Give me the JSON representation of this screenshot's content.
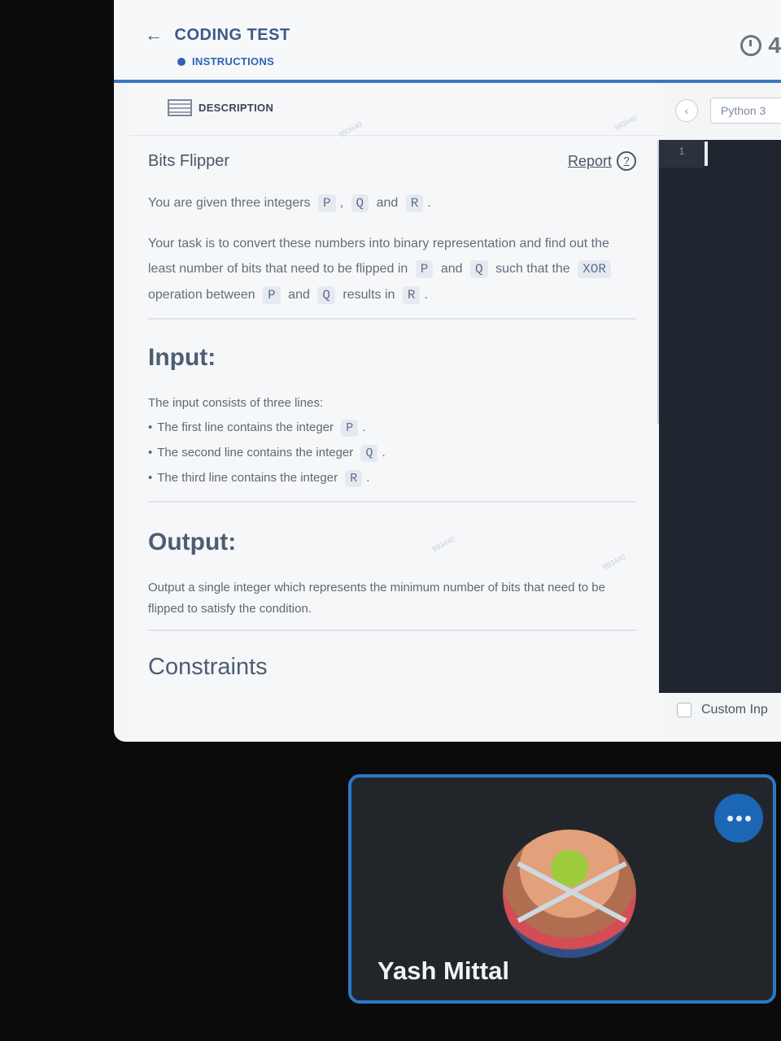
{
  "header": {
    "back_label": "CODING TEST",
    "instructions_label": "INSTRUCTIONS",
    "timer_text": "4"
  },
  "tabs": {
    "description_label": "DESCRIPTION"
  },
  "problem": {
    "title": "Bits Flipper",
    "report_label": "Report",
    "intro_prefix": "You are given three integers",
    "intro_p": "P",
    "intro_sep1": ",",
    "intro_q": "Q",
    "intro_and": "and",
    "intro_r": "R",
    "intro_end": ".",
    "task_1": "Your task is to convert these numbers into binary representation and find out the least number of bits that need to be flipped in",
    "task_p": "P",
    "task_and1": "and",
    "task_q": "Q",
    "task_2": "such that the",
    "task_xor": "XOR",
    "task_3": "operation between",
    "task_p2": "P",
    "task_and2": "and",
    "task_q2": "Q",
    "task_4": "results in",
    "task_r": "R",
    "task_end": ".",
    "input_heading": "Input:",
    "input_desc": "The input consists of three lines:",
    "input_lines": [
      {
        "text": "The first line contains the integer",
        "var": "P"
      },
      {
        "text": "The second line contains the integer",
        "var": "Q"
      },
      {
        "text": "The third line contains the integer",
        "var": "R"
      }
    ],
    "output_heading": "Output:",
    "output_desc": "Output a single integer which represents the minimum number of bits that need to be flipped to satisfy the condition.",
    "constraints_heading": "Constraints"
  },
  "editor": {
    "language": "Python 3",
    "line_number": "1",
    "custom_input_label": "Custom Inp"
  },
  "call": {
    "participant_name": "Yash Mittal"
  }
}
